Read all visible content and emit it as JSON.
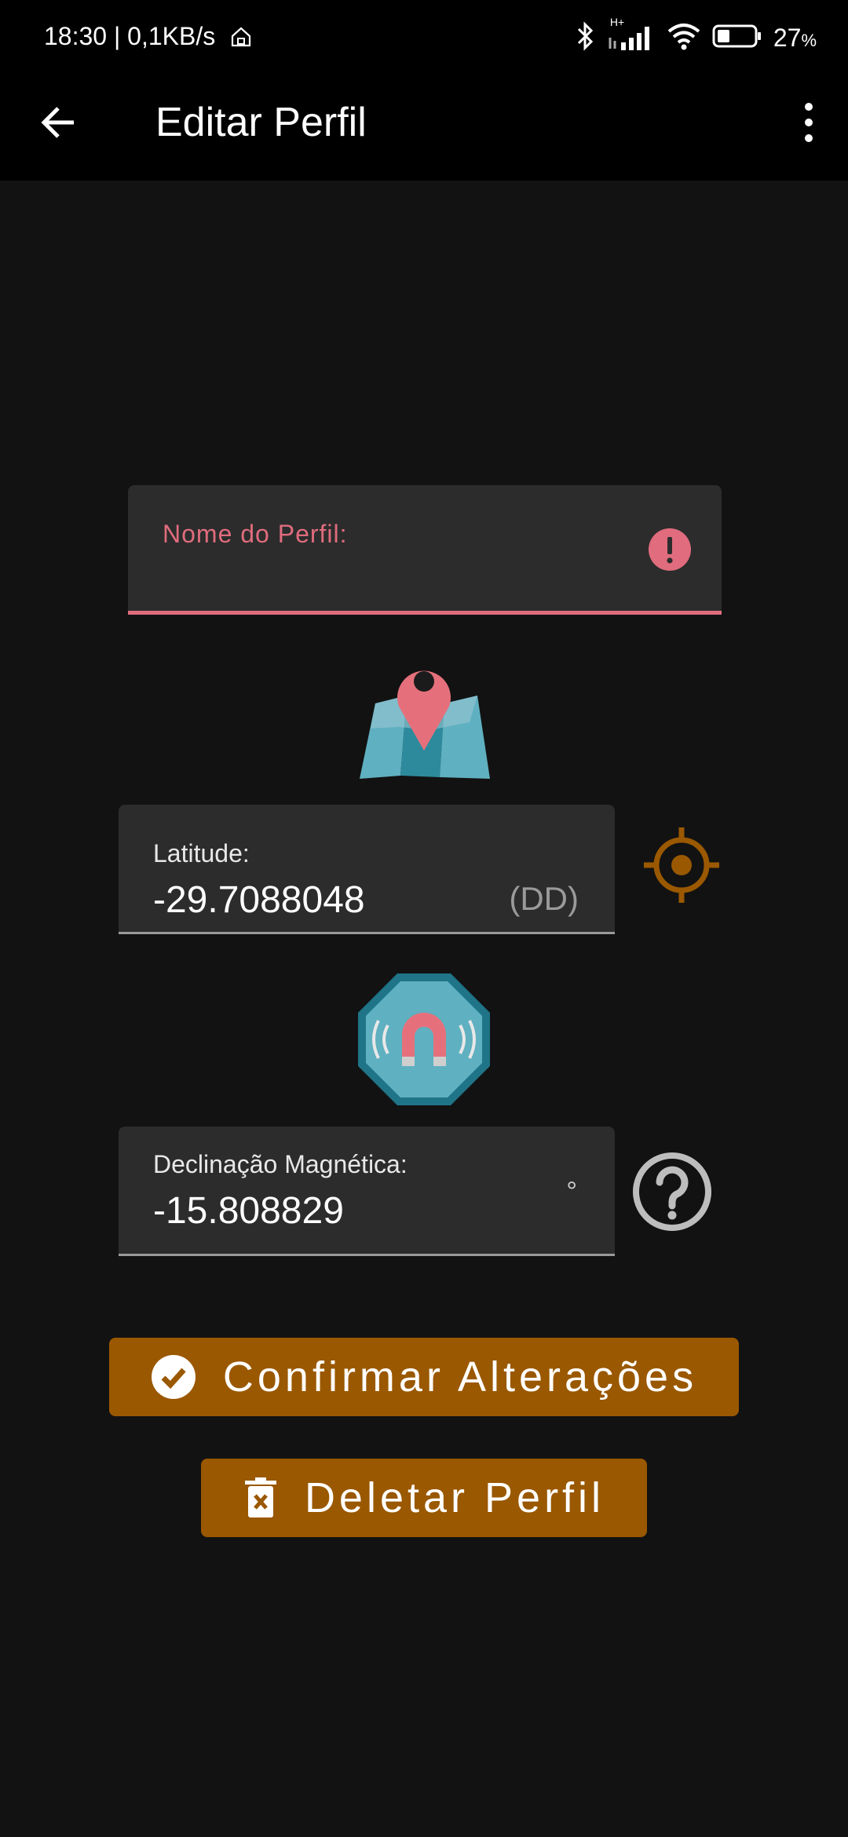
{
  "status_bar": {
    "time": "18:30 | 0,1KB/s",
    "network_type": "H+",
    "battery_percent": "27",
    "battery_unit": "%"
  },
  "app_bar": {
    "title": "Editar Perfil"
  },
  "form": {
    "profile_name": {
      "label": "Nome do Perfil:",
      "value": "",
      "state": "error"
    },
    "latitude": {
      "label": "Latitude:",
      "value": "-29.7088048",
      "suffix": "(DD)"
    },
    "declination": {
      "label": "Declinação Magnética:",
      "value": "-15.808829",
      "suffix": "°"
    }
  },
  "actions": {
    "confirm_label": "Confirmar Alterações",
    "delete_label": "Deletar Perfil"
  },
  "colors": {
    "accent": "#9a5800",
    "error": "#e06c7d",
    "background": "#121212",
    "field_background": "#2c2c2c"
  }
}
